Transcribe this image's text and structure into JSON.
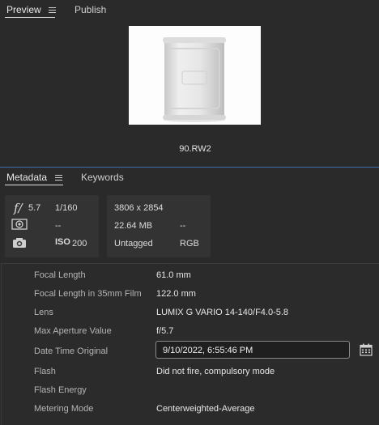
{
  "top_tabs": [
    {
      "label": "Preview",
      "active": true
    },
    {
      "label": "Publish",
      "active": false
    }
  ],
  "preview": {
    "filename": "90.RW2"
  },
  "meta_tabs": [
    {
      "label": "Metadata",
      "active": true
    },
    {
      "label": "Keywords",
      "active": false
    }
  ],
  "quick_info": {
    "aperture_symbol": "f/",
    "aperture": "5.7",
    "shutter": "1/160",
    "metering": "--",
    "iso_label": "ISO",
    "iso": "200",
    "dimensions": "3806 x 2854",
    "file_size": "22.64 MB",
    "extra": "--",
    "tagged": "Untagged",
    "color_mode": "RGB"
  },
  "properties": [
    {
      "label": "Focal Length",
      "value": "61.0 mm"
    },
    {
      "label": "Focal Length in 35mm Film",
      "value": "122.0 mm"
    },
    {
      "label": "Lens",
      "value": "LUMIX G VARIO 14-140/F4.0-5.8"
    },
    {
      "label": "Max Aperture Value",
      "value": "f/5.7"
    },
    {
      "label": "Date Time Original",
      "value": "9/10/2022, 6:55:46 PM"
    },
    {
      "label": "Flash",
      "value": "Did not fire, compulsory mode"
    },
    {
      "label": "Flash Energy",
      "value": ""
    },
    {
      "label": "Metering Mode",
      "value": "Centerweighted-Average"
    }
  ],
  "colors": {
    "accent": "#3b6ea8",
    "background": "#2a2a2a",
    "panel": "#333333"
  }
}
